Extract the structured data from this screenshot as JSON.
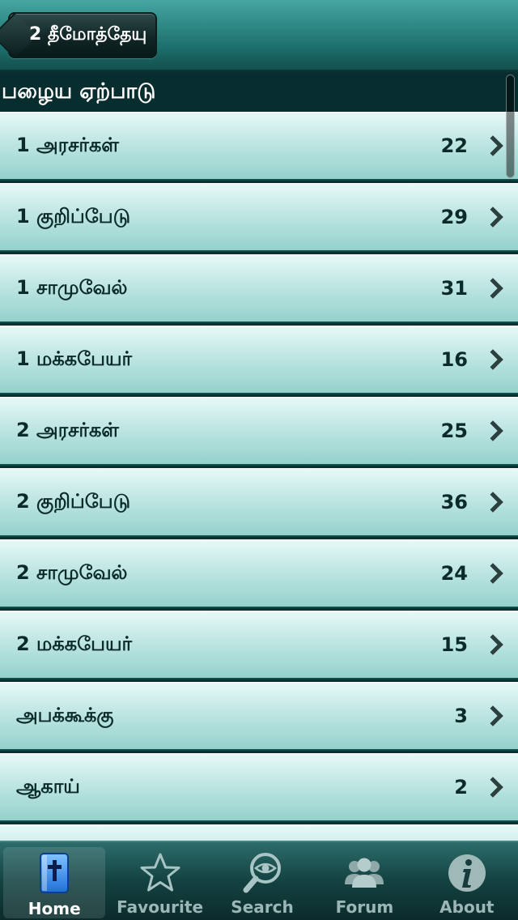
{
  "nav": {
    "back_label": "2 தீமோத்தேயு"
  },
  "section": {
    "title": "பழைய ஏற்பாடு"
  },
  "rows": [
    {
      "label": "1 அரசர்கள்",
      "count": "22"
    },
    {
      "label": "1 குறிப்பேடு",
      "count": "29"
    },
    {
      "label": "1 சாமுவேல்",
      "count": "31"
    },
    {
      "label": "1 மக்கபேயர்",
      "count": "16"
    },
    {
      "label": "2 அரசர்கள்",
      "count": "25"
    },
    {
      "label": "2 குறிப்பேடு",
      "count": "36"
    },
    {
      "label": "2 சாமுவேல்",
      "count": "24"
    },
    {
      "label": "2 மக்கபேயர்",
      "count": "15"
    },
    {
      "label": "அபக்கூக்கு",
      "count": "3"
    },
    {
      "label": "ஆகாய்",
      "count": "2"
    },
    {
      "label": "",
      "count": ""
    }
  ],
  "tabs": [
    {
      "label": "Home",
      "icon": "bible-icon",
      "active": true
    },
    {
      "label": "Favourite",
      "icon": "star-icon",
      "active": false
    },
    {
      "label": "Search",
      "icon": "magnifier-eye-icon",
      "active": false
    },
    {
      "label": "Forum",
      "icon": "people-icon",
      "active": false
    },
    {
      "label": "About",
      "icon": "info-icon",
      "active": false
    }
  ],
  "colors": {
    "header_bg": "#072d2f",
    "row_top": "#e7f8f7",
    "row_bottom": "#95d1cc",
    "accent": "#1d6d6a"
  }
}
